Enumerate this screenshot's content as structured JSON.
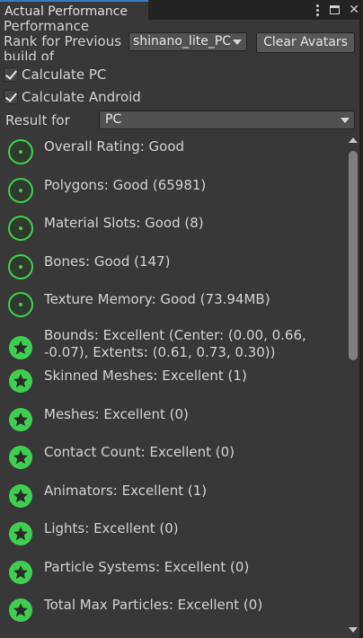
{
  "tab": {
    "title": "Actual Performance"
  },
  "header": {
    "perf_label": "Performance Rank for Previous build of",
    "avatar_dropdown": "shinano_lite_PC",
    "clear_button": "Clear Avatars",
    "calc_pc": "Calculate PC",
    "calc_android": "Calculate Android",
    "result_label": "Result for",
    "result_value": "PC"
  },
  "colors": {
    "good": "#3fcf4f",
    "background": "#383838"
  },
  "rows": [
    {
      "icon": "good-ring-icon",
      "text": "Overall Rating: Good"
    },
    {
      "icon": "good-ring-icon",
      "text": "Polygons: Good (65981)"
    },
    {
      "icon": "good-ring-icon",
      "text": "Material Slots: Good (8)"
    },
    {
      "icon": "good-ring-icon",
      "text": "Bones: Good (147)"
    },
    {
      "icon": "good-ring-icon",
      "text": "Texture Memory: Good (73.94MB)"
    },
    {
      "icon": "excellent-star-icon",
      "text": "Bounds: Excellent (Center: (0.00, 0.66, -0.07), Extents: (0.61, 0.73, 0.30))"
    },
    {
      "icon": "excellent-star-icon",
      "text": "Skinned Meshes: Excellent (1)"
    },
    {
      "icon": "excellent-star-icon",
      "text": "Meshes: Excellent (0)"
    },
    {
      "icon": "excellent-star-icon",
      "text": "Contact Count: Excellent (0)"
    },
    {
      "icon": "excellent-star-icon",
      "text": "Animators: Excellent (1)"
    },
    {
      "icon": "excellent-star-icon",
      "text": "Lights: Excellent (0)"
    },
    {
      "icon": "excellent-star-icon",
      "text": "Particle Systems: Excellent (0)"
    },
    {
      "icon": "excellent-star-icon",
      "text": "Total Max Particles: Excellent (0)"
    }
  ]
}
